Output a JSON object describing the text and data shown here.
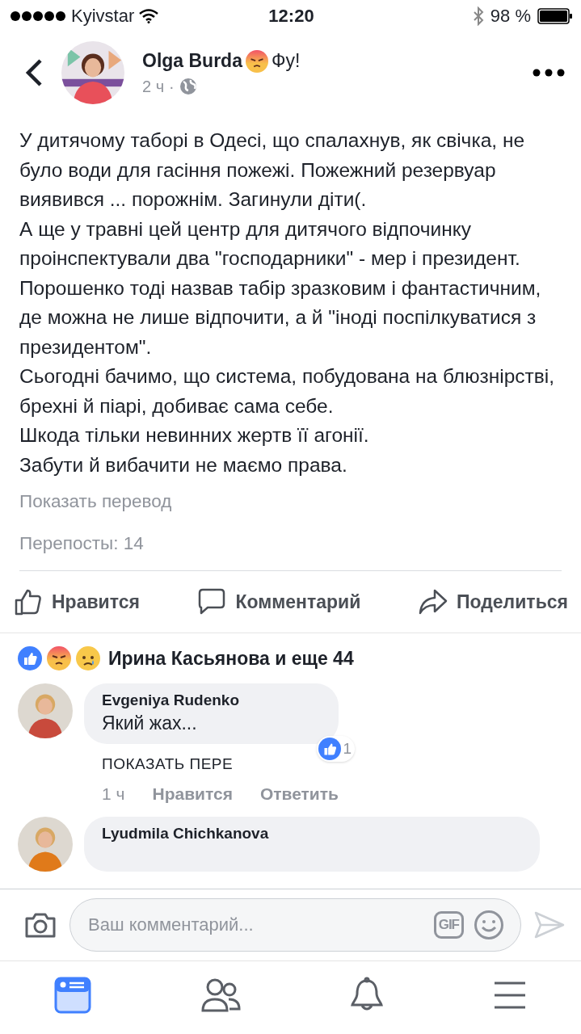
{
  "status_bar": {
    "carrier": "Kyivstar",
    "time": "12:20",
    "battery": "98 %"
  },
  "post": {
    "author": "Olga Burda",
    "feeling": "Фу!",
    "time": "2 ч",
    "separator": "·",
    "paragraphs": [
      "У дитячому таборі в Одесі, що  спалахнув, як свічка, не було води для гасіння пожежі. Пожежний резервуар виявився ... порожнім. Загинули діти(.",
      "А ще у травні цей центр для дитячого відпочинку проінспектували два \"господарники\" - мер і президент. Порошенко тоді назвав табір зразковим і фантастичним, де можна не лише відпочити, а й \"іноді поспілкуватися з президентом\".",
      "Сьогодні бачимо, що система, побудована на блюзнірстві, брехні й піарі, добиває сама себе.",
      "Шкода тільки невинних жертв її агонії.",
      "Забути й вибачити не маємо права."
    ],
    "translate": "Показать перевод",
    "shares": "Перепосты: 14"
  },
  "actions": [
    {
      "kind": "like",
      "label": "Нравится"
    },
    {
      "kind": "comment",
      "label": "Комментарий"
    },
    {
      "kind": "share",
      "label": "Поделиться"
    }
  ],
  "reactions": {
    "icons": [
      {
        "kind": "like"
      },
      {
        "kind": "angry"
      },
      {
        "kind": "sad"
      }
    ],
    "summary": "Ирина Касьянова и еще 44"
  },
  "comments": [
    {
      "author": "Evgeniya Rudenko",
      "text": "Який жах...",
      "translate": "ПОКАЗАТЬ ПЕРЕ",
      "likes": "1",
      "time": "1 ч",
      "like": "Нравится",
      "reply": "Ответить"
    },
    {
      "author": "Lyudmila Chichkanova"
    }
  ],
  "composer": {
    "placeholder": "Ваш комментарий...",
    "gif": "GIF"
  },
  "tabs": [
    {
      "kind": "feed",
      "selected": true
    },
    {
      "kind": "friends",
      "selected": false
    },
    {
      "kind": "notifications",
      "selected": false
    },
    {
      "kind": "menu",
      "selected": false
    }
  ]
}
